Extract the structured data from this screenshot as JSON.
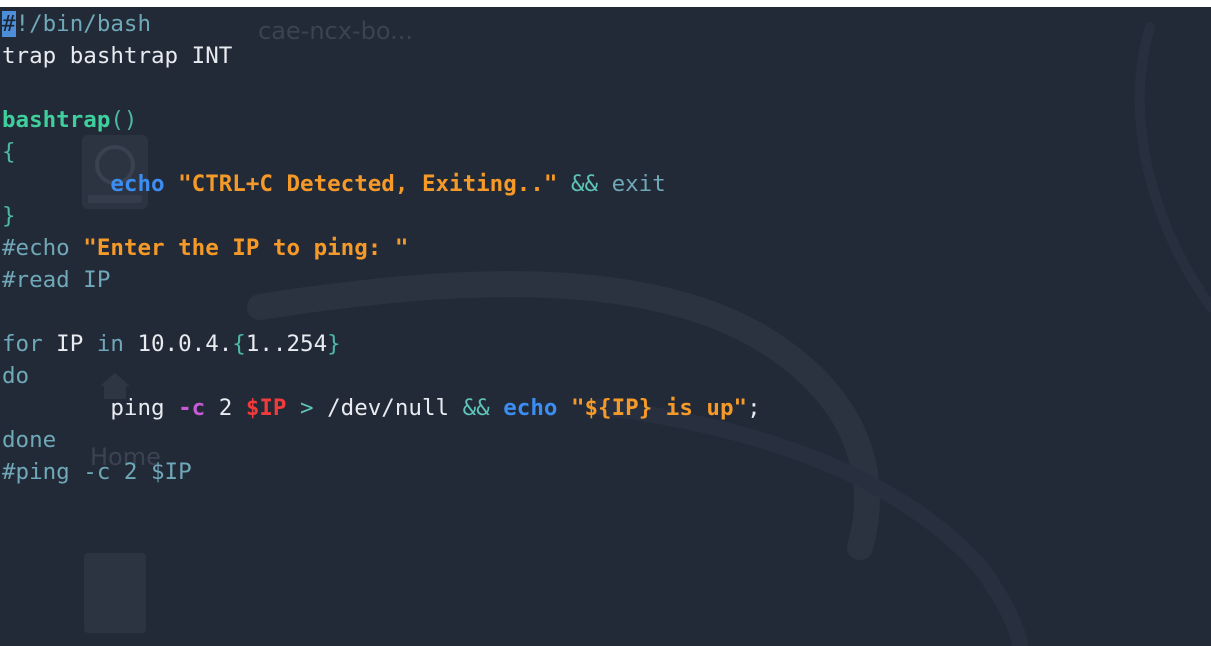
{
  "background_ghosts": {
    "window_label": "cae-ncx-bo...",
    "home_label": "Home"
  },
  "editor": {
    "lines": [
      [
        {
          "cls": "cursor",
          "text": "#"
        },
        {
          "cls": "c-comment",
          "text": "!/bin/bash"
        }
      ],
      [
        {
          "cls": "c-plain",
          "text": "trap bashtrap INT"
        }
      ],
      [
        {
          "cls": "c-plain",
          "text": ""
        }
      ],
      [
        {
          "cls": "c-fn",
          "text": "bashtrap"
        },
        {
          "cls": "c-brace",
          "text": "()"
        }
      ],
      [
        {
          "cls": "c-brace",
          "text": "{"
        }
      ],
      [
        {
          "cls": "c-plain",
          "text": "        "
        },
        {
          "cls": "c-builtin",
          "text": "echo"
        },
        {
          "cls": "c-plain",
          "text": " "
        },
        {
          "cls": "c-string",
          "text": "\"CTRL+C Detected, Exiting..\""
        },
        {
          "cls": "c-plain",
          "text": " "
        },
        {
          "cls": "c-op",
          "text": "&&"
        },
        {
          "cls": "c-plain",
          "text": " "
        },
        {
          "cls": "c-keyword",
          "text": "exit"
        }
      ],
      [
        {
          "cls": "c-brace",
          "text": "}"
        }
      ],
      [
        {
          "cls": "c-comment",
          "text": "#echo "
        },
        {
          "cls": "c-string",
          "text": "\"Enter the IP to ping: \""
        }
      ],
      [
        {
          "cls": "c-comment",
          "text": "#read IP"
        }
      ],
      [
        {
          "cls": "c-plain",
          "text": ""
        }
      ],
      [
        {
          "cls": "c-keyword",
          "text": "for"
        },
        {
          "cls": "c-plain",
          "text": " IP "
        },
        {
          "cls": "c-keyword",
          "text": "in"
        },
        {
          "cls": "c-plain",
          "text": " 10.0.4."
        },
        {
          "cls": "c-brace",
          "text": "{"
        },
        {
          "cls": "c-plain",
          "text": "1..254"
        },
        {
          "cls": "c-brace",
          "text": "}"
        }
      ],
      [
        {
          "cls": "c-keyword",
          "text": "do"
        }
      ],
      [
        {
          "cls": "c-plain",
          "text": "        ping "
        },
        {
          "cls": "c-flag",
          "text": "-c"
        },
        {
          "cls": "c-plain",
          "text": " 2 "
        },
        {
          "cls": "c-var",
          "text": "$IP"
        },
        {
          "cls": "c-plain",
          "text": " "
        },
        {
          "cls": "c-op",
          "text": ">"
        },
        {
          "cls": "c-plain",
          "text": " /dev/null "
        },
        {
          "cls": "c-op",
          "text": "&&"
        },
        {
          "cls": "c-plain",
          "text": " "
        },
        {
          "cls": "c-builtin",
          "text": "echo"
        },
        {
          "cls": "c-plain",
          "text": " "
        },
        {
          "cls": "c-string",
          "text": "\"${IP} is up\""
        },
        {
          "cls": "c-plain",
          "text": ";"
        }
      ],
      [
        {
          "cls": "c-keyword",
          "text": "done"
        }
      ],
      [
        {
          "cls": "c-comment",
          "text": "#ping -c 2 $IP"
        }
      ]
    ]
  }
}
